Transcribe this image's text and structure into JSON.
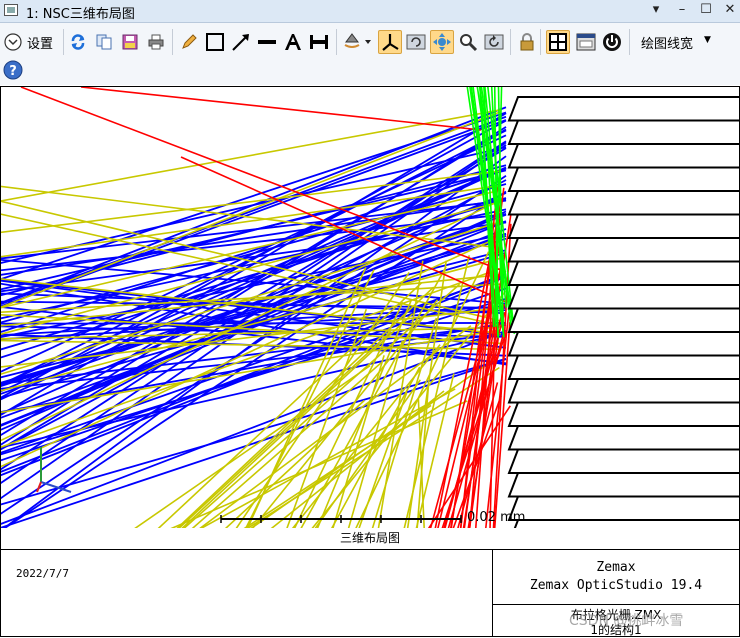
{
  "window": {
    "title": "1: NSC三维布局图",
    "controls": [
      "▾",
      "–",
      "☐",
      "✕"
    ]
  },
  "toolbar": {
    "settings_label": "设置",
    "line_width_label": "绘图线宽",
    "icons": [
      "refresh-icon",
      "copy-icon",
      "save-icon",
      "print-icon",
      "pencil-icon",
      "rectangle-icon",
      "arrow-icon",
      "line-icon",
      "text-icon",
      "dimension-icon",
      "rotate-3d-icon",
      "axes-icon",
      "rotate-view-icon",
      "pan-icon",
      "zoom-icon",
      "reset-view-icon",
      "lock-icon",
      "layout-icon",
      "window-icon",
      "power-icon",
      "help-icon"
    ],
    "accent": "#ffd98a"
  },
  "plot": {
    "scale_label": "0.02 mm",
    "ray_colors": {
      "wavelength_1": "#0000ff",
      "wavelength_2": "#c8c800",
      "wavelength_3": "#ff0000",
      "wavelength_4": "#00ff00"
    }
  },
  "info": {
    "header": "三维布局图",
    "date": "2022/7/7",
    "company": "Zemax",
    "product": "Zemax OpticStudio 19.4",
    "file": "布拉格光栅.ZMX",
    "config": "1的结构1"
  },
  "watermark": "CSDN @挑衅冰雪"
}
